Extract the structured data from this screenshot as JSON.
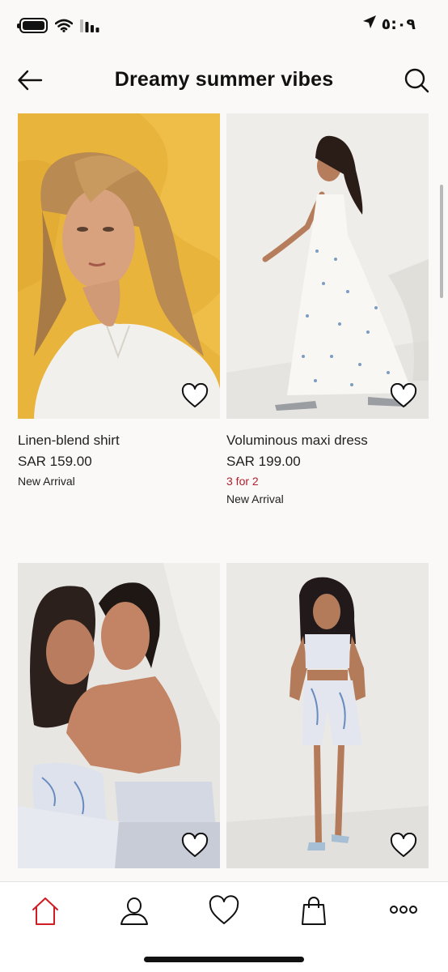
{
  "status_bar": {
    "time": "٥:٠٩",
    "icons": [
      "battery-icon",
      "wifi-icon",
      "signal-icon",
      "location-arrow-icon"
    ]
  },
  "header": {
    "title": "Dreamy summer vibes",
    "back_icon": "arrow-left-icon",
    "search_icon": "search-icon"
  },
  "products": [
    {
      "name": "Linen-blend shirt",
      "price": "SAR 159.00",
      "promo": "",
      "badge": "New Arrival",
      "image_colors": [
        "#e9b43c",
        "#f2f0ec"
      ]
    },
    {
      "name": "Voluminous maxi dress",
      "price": "SAR 199.00",
      "promo": "3 for 2",
      "badge": "New Arrival",
      "image_colors": [
        "#efedea",
        "#f7f6f2"
      ]
    },
    {
      "name": "",
      "price": "",
      "promo": "",
      "badge": "",
      "image_colors": [
        "#e8e6e2",
        "#d6dbe6"
      ]
    },
    {
      "name": "",
      "price": "",
      "promo": "",
      "badge": "",
      "image_colors": [
        "#ebe9e6",
        "#dfe3ea"
      ]
    }
  ],
  "bottom_nav": {
    "items": [
      "home-icon",
      "account-icon",
      "favourites-icon",
      "shopping-bag-icon",
      "more-icon"
    ],
    "active": "home-icon",
    "accent_color": "#d01c23"
  },
  "colors": {
    "promo": "#b0202c",
    "background": "#faf9f8"
  }
}
